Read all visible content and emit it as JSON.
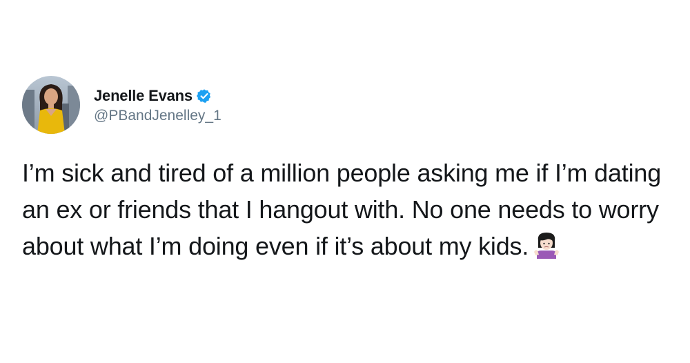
{
  "tweet": {
    "display_name": "Jenelle Evans",
    "handle": "@PBandJenelley_1",
    "verified": true,
    "text": "I’m sick and tired of a million people asking me if I’m dating an ex or friends that I hangout with. No one needs to worry about what I’m doing even if it’s about my kids.",
    "emoji": "woman-shrugging-icon"
  },
  "colors": {
    "text": "#14171a",
    "secondary": "#657786",
    "verified_badge": "#1da1f2",
    "background": "#ffffff"
  }
}
